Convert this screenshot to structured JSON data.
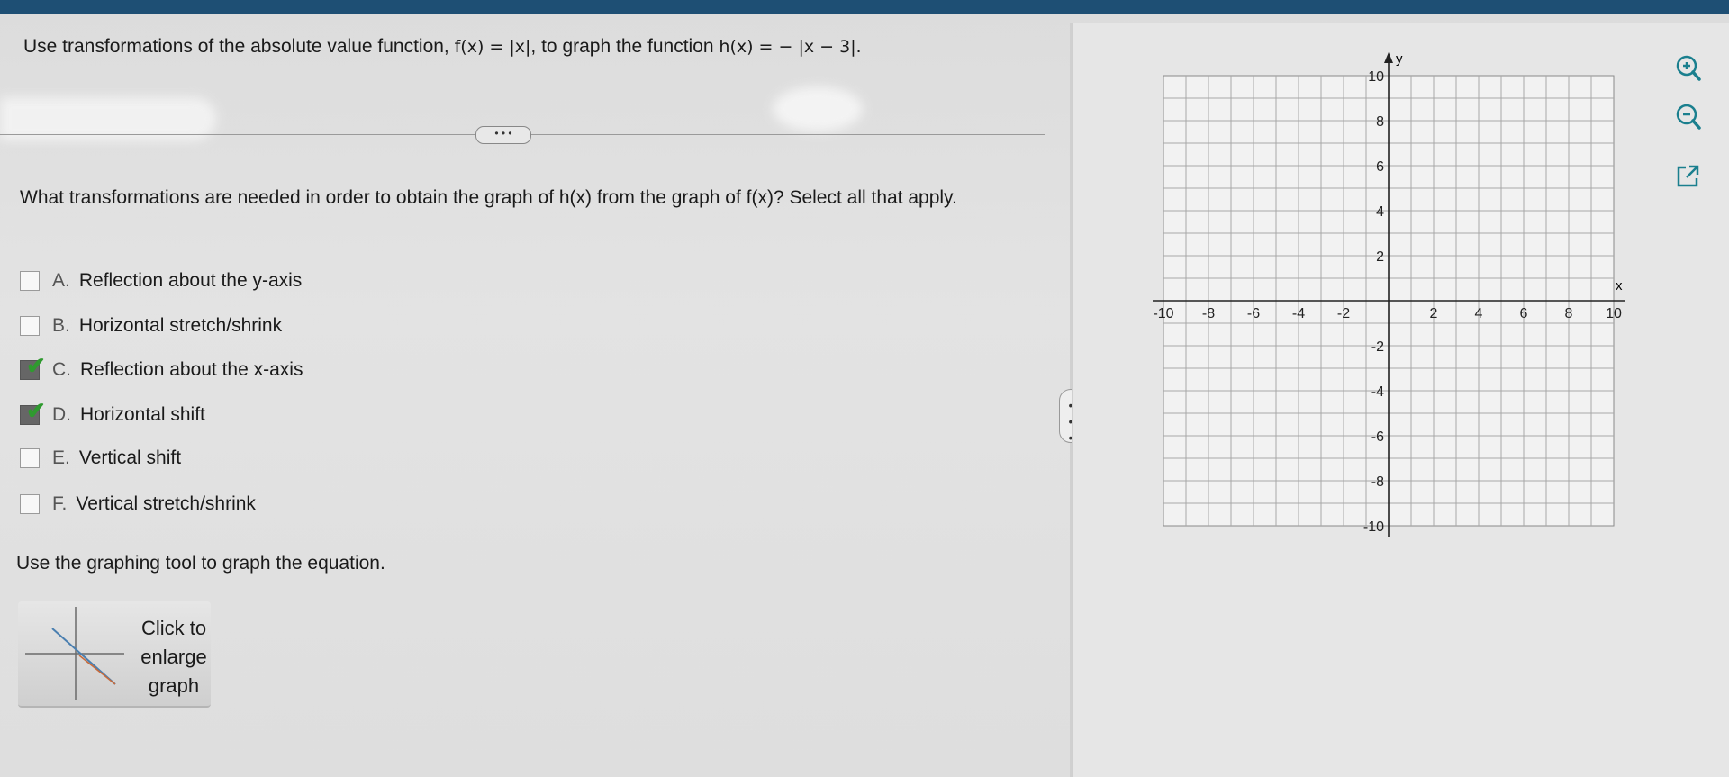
{
  "question": {
    "prefix": "Use transformations of the absolute value function, ",
    "f_expr": "f(x) = |x|",
    "middle": ", to graph the function ",
    "h_expr": "h(x) = − |x − 3|",
    "suffix": "."
  },
  "more_button_label": "• • •",
  "prompt": "What transformations are needed in order to obtain the graph of h(x) from the graph of f(x)? Select all that apply.",
  "options": [
    {
      "letter": "A.",
      "label": "Reflection about the y-axis",
      "checked": false
    },
    {
      "letter": "B.",
      "label": "Horizontal stretch/shrink",
      "checked": false
    },
    {
      "letter": "C.",
      "label": "Reflection about the x-axis",
      "checked": true
    },
    {
      "letter": "D.",
      "label": "Horizontal shift",
      "checked": true
    },
    {
      "letter": "E.",
      "label": "Vertical shift",
      "checked": false
    },
    {
      "letter": "F.",
      "label": "Vertical stretch/shrink",
      "checked": false
    }
  ],
  "use_tool_text": "Use the graphing tool to graph the equation.",
  "enlarge_button": {
    "line1": "Click to",
    "line2": "enlarge",
    "line3": "graph"
  },
  "graph": {
    "x_label": "x",
    "y_label": "y",
    "x_ticks": [
      "-10",
      "-8",
      "-6",
      "-4",
      "-2",
      "2",
      "4",
      "6",
      "8",
      "10"
    ],
    "y_ticks": [
      "10",
      "8",
      "6",
      "4",
      "2",
      "-2",
      "-4",
      "-6",
      "-8",
      "-10"
    ]
  },
  "icons": {
    "zoom_in": "zoom-in-icon",
    "zoom_out": "zoom-out-icon",
    "popout": "external-link-icon"
  },
  "colors": {
    "topbar": "#1e4f74",
    "icon_teal": "#1a7f8e",
    "check_green": "#2f9a2f"
  }
}
